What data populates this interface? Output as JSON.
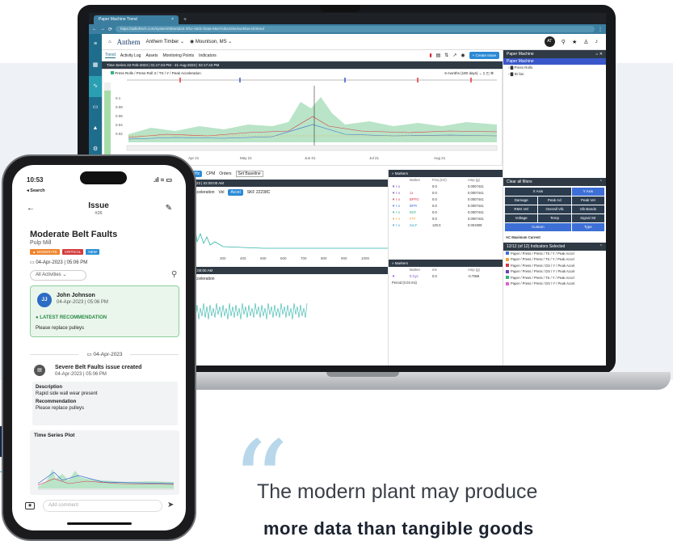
{
  "browser": {
    "tab_title": "Paper Machine Trend",
    "url": "https://adkcftech.com/system/0b6e0d43-3f1e-46d1-b0a6-68a7/vibe225x/workbench/trend"
  },
  "app": {
    "company": "Anthem Timber",
    "brand": "Anthem",
    "location": "Mountson, MS",
    "subnav": [
      "Trend",
      "Activity Log",
      "Assets",
      "Monitoring Points",
      "Indicators"
    ],
    "create_issue": "+ Create Issue",
    "ts_bar": "Time Series   22-Feb-2023 | 01:17:43 PM - 21-Aug-2023 | 02:17:43 PM",
    "chart_path": "Press Rolls / Press Roll 3 / TS / Y / Peak Acceleration",
    "range": "6 months (180 days)",
    "y_ticks": [
      "0.1",
      "0.08",
      "0.06",
      "0.04",
      "0.02"
    ],
    "x_ticks": [
      "Apr 21",
      "May 21",
      "Jun 01",
      "Jul 21",
      "Aug 21"
    ],
    "panel_title": "Paper Machine",
    "tree_items": [
      "Press Rolls",
      "ID fan"
    ],
    "clear_filters": "Clear all filters",
    "filters": [
      "X Axis",
      "Y Axis",
      "Damage",
      "Peak Acl",
      "Peak Vel",
      "RMS Vel",
      "Overall Vib",
      "Vib Bands",
      "Voltage",
      "Temp",
      "Signal Str",
      "Custom",
      "Type"
    ],
    "ac_current": "AC Maximum Current",
    "indicators_selected": "12/12 (of 12) Indicators Selected",
    "indicator_rows": [
      {
        "label": "Paper / Press / Press / TS / Y / Peak Accel",
        "color": "#3b6fd6"
      },
      {
        "label": "Paper / Press / Press / TS / Y / Peak Accel",
        "color": "#f2a531"
      },
      {
        "label": "Paper / Press / Press / DS / Y / Peak Accel",
        "color": "#d9344a"
      },
      {
        "label": "Paper / Press / Press / DS / Y / Peak Accel",
        "color": "#6a3fb8"
      },
      {
        "label": "Paper / Press / Press / TS / Y / Peak Accel",
        "color": "#2fb57f"
      },
      {
        "label": "Paper / Press / Press / DS / Y / Peak Accel",
        "color": "#e25fc7"
      }
    ],
    "spectrum_bar": "2023 | 02:00:00 AM",
    "spectrum_ctrl": [
      "Hz",
      "CPM",
      "Orders",
      "Set Baseline"
    ],
    "spec_label": "Acceleration",
    "spec_opts": [
      "Vel",
      "Accel",
      "SKF 22238C"
    ],
    "spec_xticks": [
      "300",
      "400",
      "500",
      "600",
      "700",
      "800",
      "900",
      "1000"
    ],
    "wave_bar": "02:00:00 AM",
    "wave_label": "Acceleration",
    "markers_title": "Markers",
    "markers_cols": [
      "Marker",
      "Freq (Hz)",
      "Amp (g)"
    ],
    "markers_rows": [
      [
        "",
        "0.0",
        "0.0007441"
      ],
      [
        "1x",
        "0.0",
        "0.0007441"
      ],
      [
        "BPFO",
        "0.0",
        "0.0007441"
      ],
      [
        "BPFI",
        "0.0",
        "0.0007441"
      ],
      [
        "BSF",
        "0.0",
        "0.0007441"
      ],
      [
        "FTF",
        "0.0",
        "0.0007441"
      ],
      [
        "2xLF",
        "120.0",
        "0.001909"
      ]
    ],
    "markers2_cols": [
      "Marker",
      "ms",
      "Amp (g)"
    ],
    "markers2_row": [
      "0 Cyc",
      "0.0",
      "-0.7968"
    ],
    "period": "Period (0.03 ms)"
  },
  "phone": {
    "time": "10:53",
    "back_link": "◂ Search",
    "header_title": "Issue",
    "header_num": "#26",
    "issue_title": "Moderate Belt Faults",
    "issue_sub": "Pulp Mill",
    "badges": [
      {
        "label": "MODERATE",
        "color": "#f0842c"
      },
      {
        "label": "CRITICAL",
        "color": "#d43b3b"
      },
      {
        "label": "NEW",
        "color": "#2e90d6"
      }
    ],
    "issue_date": "04-Apr-2023 | 05:06 PM",
    "activities": "All Activities",
    "commenter": "John Johnson",
    "comment_date": "04-Apr-2023 | 05:06 PM",
    "latest_rec": "LATEST RECOMMENDATION",
    "rec_text": "Please replace pulleys",
    "divider_date": "04-Apr-2023",
    "event_title": "Severe Belt Faults issue created",
    "event_date": "04-Apr-2023 | 05:06 PM",
    "desc_label": "Description",
    "desc_text": "Rapid side wall wear present",
    "rec_label": "Recommendation",
    "rec2_text": "Please replace pulleys",
    "plot_title": "Time Series Plot",
    "comment_placeholder": "Add comment"
  },
  "quote": {
    "line1": "The modern plant may produce",
    "line2": "more data than tangible goods"
  }
}
